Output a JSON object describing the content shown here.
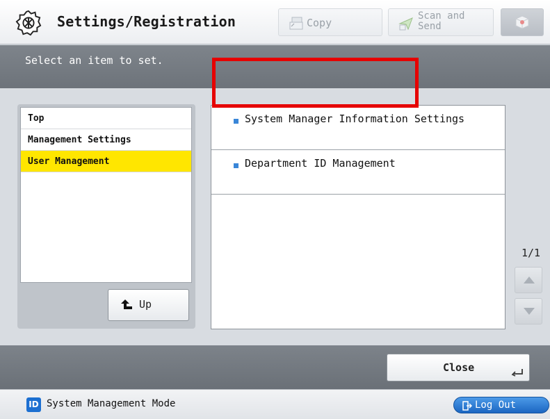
{
  "header": {
    "title": "Settings/Registration",
    "functions": [
      {
        "label": "Copy",
        "icon": "copy-icon",
        "enabled": false
      },
      {
        "label": "Scan and\nSend",
        "icon": "scan-send-icon",
        "enabled": false
      },
      {
        "label": "",
        "icon": "box-icon",
        "enabled": false
      }
    ]
  },
  "instruction": "Select an item to set.",
  "tree": {
    "items": [
      {
        "label": "Top",
        "selected": false
      },
      {
        "label": "Management Settings",
        "selected": false
      },
      {
        "label": "User Management",
        "selected": true
      }
    ],
    "up_label": "Up"
  },
  "list": {
    "items": [
      {
        "label": "System Manager Information Settings",
        "highlighted": false
      },
      {
        "label": "Department ID Management",
        "highlighted": true
      }
    ],
    "page": "1/1"
  },
  "actions": {
    "close_label": "Close"
  },
  "status": {
    "id_badge": "ID",
    "mode_text": "System Management Mode",
    "logout_label": "Log Out"
  },
  "colors": {
    "selected_item": "#ffe600",
    "highlight_frame": "#e60000",
    "bullet": "#3a86d8",
    "logout_button": "#1b66c2"
  }
}
